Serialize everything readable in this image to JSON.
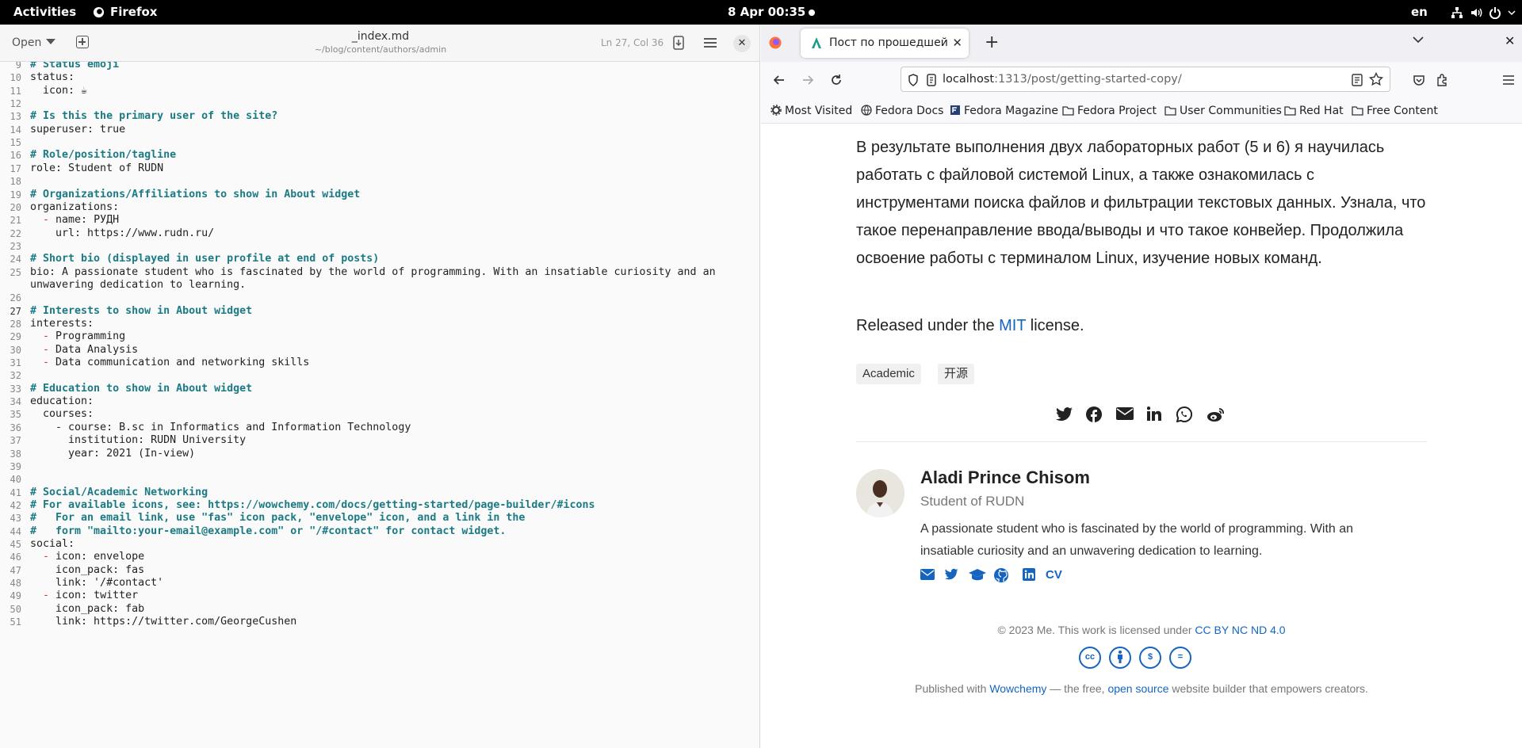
{
  "topbar": {
    "activities": "Activities",
    "app": "Firefox",
    "clock": "8 Apr  00:35",
    "lang": "en"
  },
  "editor": {
    "open_label": "Open",
    "title": "_index.md",
    "path": "~/blog/content/authors/admin",
    "position": "Ln 27, Col 36",
    "lines": [
      {
        "n": "9",
        "t": "# Status emoji",
        "k": "comment"
      },
      {
        "n": "10",
        "t": "status:",
        "k": "plain"
      },
      {
        "n": "11",
        "t": "  icon: ☕",
        "k": "plain"
      },
      {
        "n": "12",
        "t": "",
        "k": "plain"
      },
      {
        "n": "13",
        "t": "# Is this the primary user of the site?",
        "k": "comment"
      },
      {
        "n": "14",
        "t": "superuser: true",
        "k": "plain"
      },
      {
        "n": "15",
        "t": "",
        "k": "plain"
      },
      {
        "n": "16",
        "t": "# Role/position/tagline",
        "k": "comment"
      },
      {
        "n": "17",
        "t": "role: Student of RUDN",
        "k": "plain"
      },
      {
        "n": "18",
        "t": "",
        "k": "plain"
      },
      {
        "n": "19",
        "t": "# Organizations/Affiliations to show in About widget",
        "k": "comment"
      },
      {
        "n": "20",
        "t": "organizations:",
        "k": "plain"
      },
      {
        "n": "21",
        "t": "name: РУДН",
        "k": "dash"
      },
      {
        "n": "22",
        "t": "    url: https://www.rudn.ru/",
        "k": "plain"
      },
      {
        "n": "23",
        "t": "",
        "k": "plain"
      },
      {
        "n": "24",
        "t": "# Short bio (displayed in user profile at end of posts)",
        "k": "comment"
      },
      {
        "n": "25",
        "t": "bio: A passionate student who is fascinated by the world of programming. With an insatiable curiosity and an",
        "k": "plain"
      },
      {
        "n": "",
        "t": "unwavering dedication to learning.",
        "k": "plain"
      },
      {
        "n": "26",
        "t": "",
        "k": "plain"
      },
      {
        "n": "27",
        "t": "# Interests to show in About widget",
        "k": "comment"
      },
      {
        "n": "28",
        "t": "interests:",
        "k": "plain"
      },
      {
        "n": "29",
        "t": "Programming",
        "k": "dash"
      },
      {
        "n": "30",
        "t": "Data Analysis",
        "k": "dash"
      },
      {
        "n": "31",
        "t": "Data communication and networking skills",
        "k": "dash"
      },
      {
        "n": "32",
        "t": "",
        "k": "plain"
      },
      {
        "n": "33",
        "t": "# Education to show in About widget",
        "k": "comment"
      },
      {
        "n": "34",
        "t": "education:",
        "k": "plain"
      },
      {
        "n": "35",
        "t": "  courses:",
        "k": "plain"
      },
      {
        "n": "36",
        "t": "    - course: B.sc in Informatics and Information Technology",
        "k": "plain"
      },
      {
        "n": "37",
        "t": "      institution: RUDN University",
        "k": "plain"
      },
      {
        "n": "38",
        "t": "      year: 2021 (In-view)",
        "k": "plain"
      },
      {
        "n": "39",
        "t": "",
        "k": "plain"
      },
      {
        "n": "40",
        "t": "",
        "k": "plain"
      },
      {
        "n": "41",
        "t": "# Social/Academic Networking",
        "k": "comment"
      },
      {
        "n": "42",
        "t": "# For available icons, see: https://wowchemy.com/docs/getting-started/page-builder/#icons",
        "k": "comment"
      },
      {
        "n": "43",
        "t": "#   For an email link, use \"fas\" icon pack, \"envelope\" icon, and a link in the",
        "k": "comment"
      },
      {
        "n": "44",
        "t": "#   form \"mailto:your-email@example.com\" or \"/#contact\" for contact widget.",
        "k": "comment"
      },
      {
        "n": "45",
        "t": "social:",
        "k": "plain"
      },
      {
        "n": "46",
        "t": "icon: envelope",
        "k": "dash"
      },
      {
        "n": "47",
        "t": "    icon_pack: fas",
        "k": "plain"
      },
      {
        "n": "48",
        "t": "    link: '/#contact'",
        "k": "plain"
      },
      {
        "n": "49",
        "t": "icon: twitter",
        "k": "dash"
      },
      {
        "n": "50",
        "t": "    icon_pack: fab",
        "k": "plain"
      },
      {
        "n": "51",
        "t": "    link: https://twitter.com/GeorgeCushen",
        "k": "plain"
      }
    ]
  },
  "browser": {
    "tab_title": "Пост по прошедшей неде",
    "url_host": "localhost",
    "url_rest": ":1313/post/getting-started-copy/",
    "bookmarks": [
      "Most Visited",
      "Fedora Docs",
      "Fedora Magazine",
      "Fedora Project",
      "User Communities",
      "Red Hat",
      "Free Content"
    ]
  },
  "page": {
    "paragraph": "В результате выполнения двух лабораторных работ (5 и 6) я научилась работать с файловой системой Linux, а также ознакомилась с инструментами поиска файлов и фильтрации текстовых данных. Узнала, что такое перенаправление ввода/выводы и что такое конвейер. Продолжила освоение работы с терминалом Linux, изучение новых команд.",
    "license_prefix": "Released under the ",
    "license_link": "MIT",
    "license_suffix": " license.",
    "tags": [
      "Academic",
      "开源"
    ],
    "author_name": "Aladi Prince Chisom",
    "author_role": "Student of RUDN",
    "author_bio": "A passionate student who is fascinated by the world of programming. With an insatiable curiosity and an unwavering dedication to learning.",
    "cv_label": "CV",
    "copyright_prefix": "© 2023 Me. This work is licensed under ",
    "copyright_link": "CC BY NC ND 4.0",
    "published_prefix": "Published with ",
    "published_link1": "Wowchemy",
    "published_middle": " — the free, ",
    "published_link2": "open source",
    "published_suffix": " website builder that empowers creators."
  },
  "colors": {
    "link": "#1565c0",
    "comment": "#1b7b85",
    "dash": "#d1342c"
  }
}
